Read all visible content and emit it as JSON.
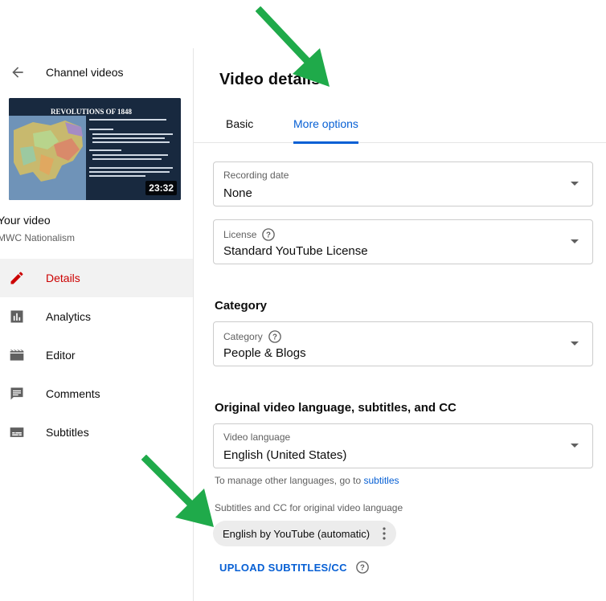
{
  "sidebar": {
    "back_label": "Channel videos",
    "thumbnail": {
      "title": "REVOLUTIONS OF 1848",
      "duration": "23:32"
    },
    "your_video_label": "Your video",
    "video_name": "MWC Nationalism",
    "nav": [
      {
        "label": "Details",
        "icon": "pencil-icon",
        "active": true
      },
      {
        "label": "Analytics",
        "icon": "analytics-icon",
        "active": false
      },
      {
        "label": "Editor",
        "icon": "editor-icon",
        "active": false
      },
      {
        "label": "Comments",
        "icon": "comments-icon",
        "active": false
      },
      {
        "label": "Subtitles",
        "icon": "subtitles-icon",
        "active": false
      }
    ]
  },
  "main": {
    "title": "Video details",
    "tabs": [
      {
        "label": "Basic",
        "active": false
      },
      {
        "label": "More options",
        "active": true
      }
    ],
    "recording_date": {
      "label": "Recording date",
      "value": "None"
    },
    "license": {
      "label": "License",
      "value": "Standard YouTube License"
    },
    "category_section": "Category",
    "category": {
      "label": "Category",
      "value": "People & Blogs"
    },
    "language_section": "Original video language, subtitles, and CC",
    "video_language": {
      "label": "Video language",
      "value": "English (United States)"
    },
    "manage_note_prefix": "To manage other languages, go to",
    "manage_note_link": "subtitles",
    "subtitles_note": "Subtitles and CC for original video language",
    "subtitle_chip": "English by YouTube (automatic)",
    "upload_button": "UPLOAD SUBTITLES/CC"
  },
  "colors": {
    "accent_blue": "#065fd4",
    "active_red": "#cc0000",
    "annotation_arrow": "#1faa4a"
  }
}
